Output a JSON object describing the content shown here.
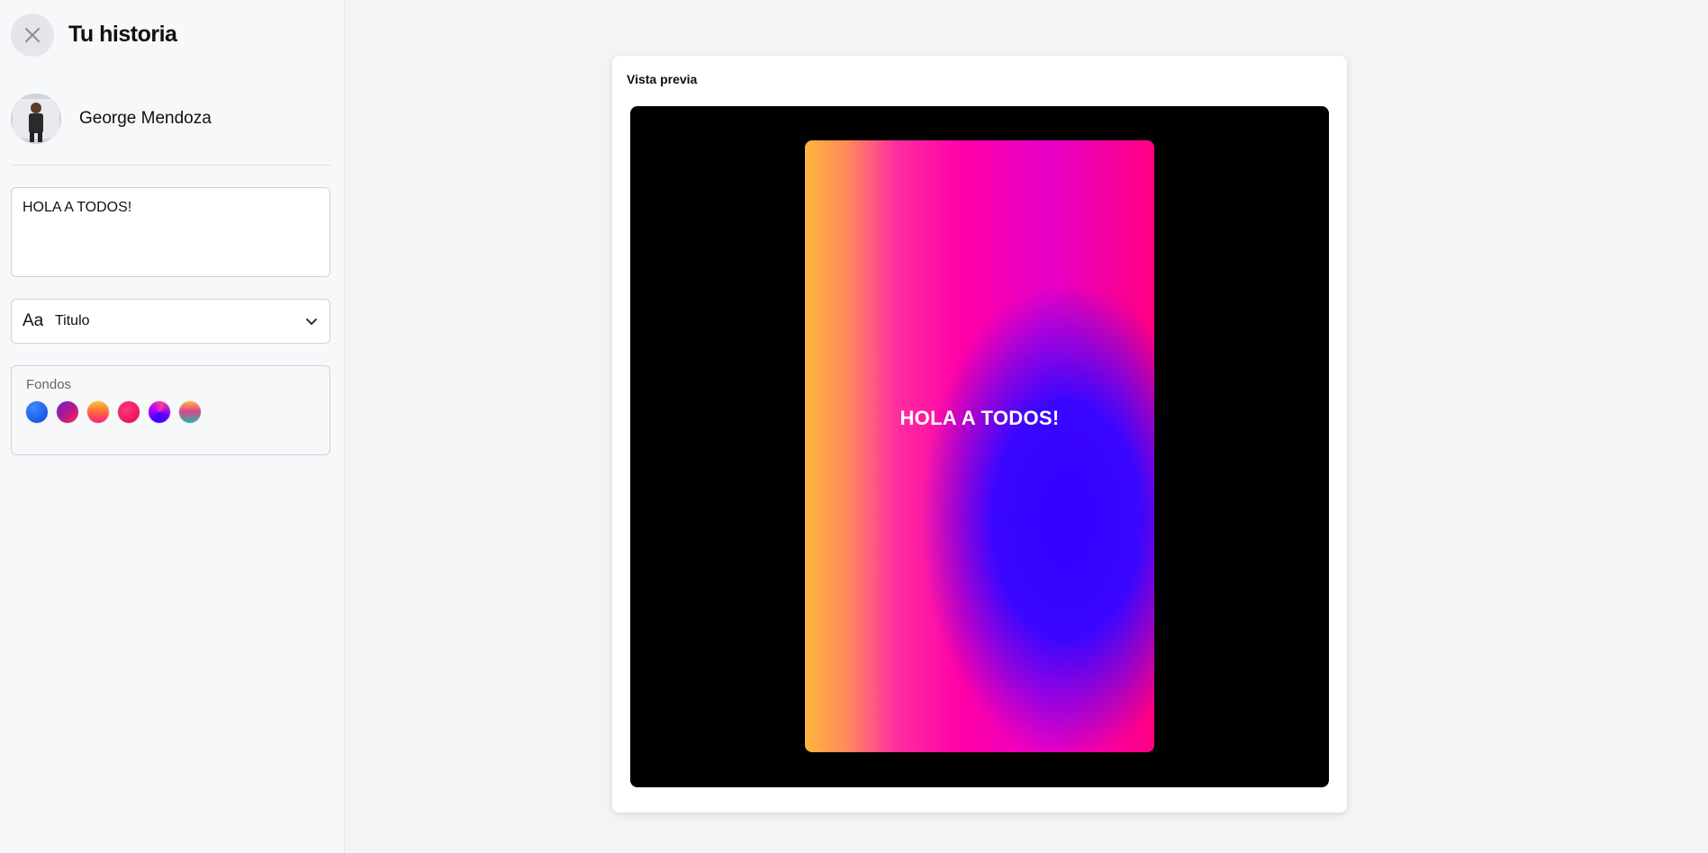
{
  "sidebar": {
    "title": "Tu historia",
    "user": {
      "name": "George Mendoza"
    },
    "text_input": {
      "value": "HOLA A TODOS!"
    },
    "font_select": {
      "icon": "Aa",
      "value": "Titulo"
    },
    "backgrounds": {
      "label": "Fondos",
      "swatches": [
        {
          "name": "blue",
          "color": "#1560ff"
        },
        {
          "name": "purple-red",
          "color": "#b4169c"
        },
        {
          "name": "orange-pink",
          "color": "#ff6a3d"
        },
        {
          "name": "pink",
          "color": "#ff0a64"
        },
        {
          "name": "violet",
          "color": "#6a1bff"
        },
        {
          "name": "rainbow",
          "color": "#e0633a"
        }
      ]
    }
  },
  "preview": {
    "label": "Vista previa",
    "story_text": "HOLA A TODOS!"
  }
}
